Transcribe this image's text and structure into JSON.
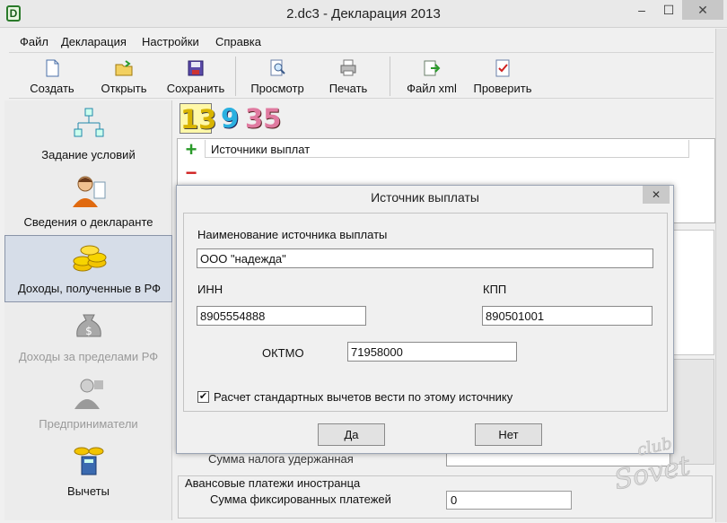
{
  "window": {
    "title": "2.dc3 - Декларация 2013",
    "app_icon_letter": "D",
    "min_glyph": "‒",
    "max_glyph": "☐",
    "close_glyph": "✕"
  },
  "menu": [
    "Файл",
    "Декларация",
    "Настройки",
    "Справка"
  ],
  "toolbar": [
    {
      "label": "Создать",
      "icon": "new-document-icon"
    },
    {
      "label": "Открыть",
      "icon": "open-folder-icon"
    },
    {
      "label": "Сохранить",
      "icon": "floppy-disk-icon"
    },
    {
      "label": "Просмотр",
      "icon": "magnifier-preview-icon"
    },
    {
      "label": "Печать",
      "icon": "printer-icon"
    },
    {
      "label": "Файл xml",
      "icon": "xml-export-icon"
    },
    {
      "label": "Проверить",
      "icon": "check-document-icon"
    }
  ],
  "nav": [
    {
      "label": "Задание условий",
      "icon": "conditions-tree-icon",
      "state": "normal"
    },
    {
      "label": "Сведения о декларанте",
      "icon": "person-declarant-icon",
      "state": "normal"
    },
    {
      "label": "Доходы, полученные в РФ",
      "icon": "gold-coins-icon",
      "state": "active"
    },
    {
      "label": "Доходы за пределами РФ",
      "icon": "money-bag-icon",
      "state": "disabled"
    },
    {
      "label": "Предприниматели",
      "icon": "businessman-icon",
      "state": "disabled"
    },
    {
      "label": "Вычеты",
      "icon": "deductions-icon",
      "state": "normal"
    }
  ],
  "rates": {
    "r13": "13",
    "r9": "9",
    "r35": "35"
  },
  "sources": {
    "add_glyph": "+",
    "remove_glyph": "−",
    "column_header": "Источники выплат"
  },
  "background_form": {
    "tax_withheld_label": "Сумма налога удержанная",
    "advance_group_title": "Авансовые платежи иностранца",
    "fixed_payments_label": "Сумма фиксированных платежей",
    "fixed_payments_value": "0"
  },
  "dialog": {
    "title": "Источник выплаты",
    "close_glyph": "✕",
    "name_label": "Наименование источника выплаты",
    "name_value": "ООО \"надежда\"",
    "inn_label": "ИНН",
    "inn_value": "8905554888",
    "kpp_label": "КПП",
    "kpp_value": "890501001",
    "oktmo_label": "ОКТМО",
    "oktmo_value": "71958000",
    "checkbox_label": "Расчет стандартных вычетов вести по этому источнику",
    "checkbox_checked": true,
    "checkbox_glyph": "✔",
    "ok_label": "Да",
    "cancel_label": "Нет"
  },
  "watermark": {
    "line1": "club",
    "line2": "Sovet"
  }
}
